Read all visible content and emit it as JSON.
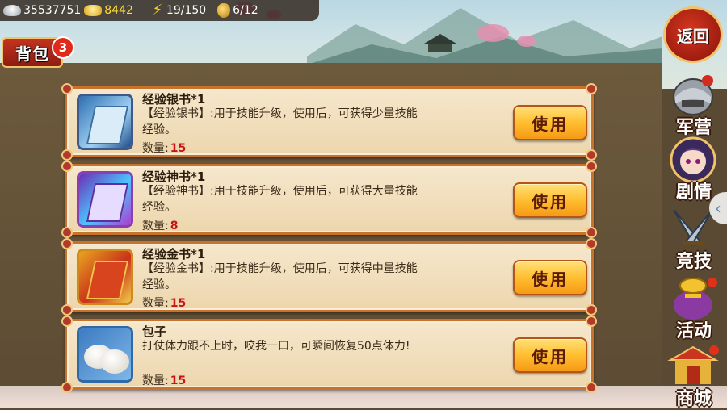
{
  "status": {
    "silver": "35537751",
    "gold": "8442",
    "stamina": "19/150",
    "bags": "6/12"
  },
  "bag_tab": {
    "label": "背包",
    "badge": "3"
  },
  "back_button": {
    "label": "返回"
  },
  "qty_label": "数量:",
  "use_label": "使用",
  "items": [
    {
      "name": "经验银书*1",
      "desc": "【经验银书】:用于技能升级，使用后，可获得少量技能经验。",
      "qty": "15",
      "icon": "silver-exp-book-icon"
    },
    {
      "name": "经验神书*1",
      "desc": "【经验神书】:用于技能升级，使用后，可获得大量技能经验。",
      "qty": "8",
      "icon": "divine-exp-book-icon"
    },
    {
      "name": "经验金书*1",
      "desc": "【经验金书】:用于技能升级，使用后，可获得中量技能经验。",
      "qty": "15",
      "icon": "gold-exp-book-icon"
    },
    {
      "name": "包子",
      "desc": "打仗体力跟不上时，咬我一口，可瞬间恢复50点体力!",
      "qty": "15",
      "icon": "steamed-bun-icon"
    }
  ],
  "menu": [
    {
      "label": "军营",
      "icon": "helmet-icon"
    },
    {
      "label": "剧情",
      "icon": "character-portrait-icon"
    },
    {
      "label": "竞技",
      "icon": "crossed-swords-icon"
    },
    {
      "label": "活动",
      "icon": "treasure-bag-icon"
    },
    {
      "label": "商城",
      "icon": "shop-pavilion-icon"
    }
  ],
  "colors": {
    "use_button": "#ffbe2f",
    "card_border": "#c8722b",
    "qty_value": "#c81414"
  }
}
